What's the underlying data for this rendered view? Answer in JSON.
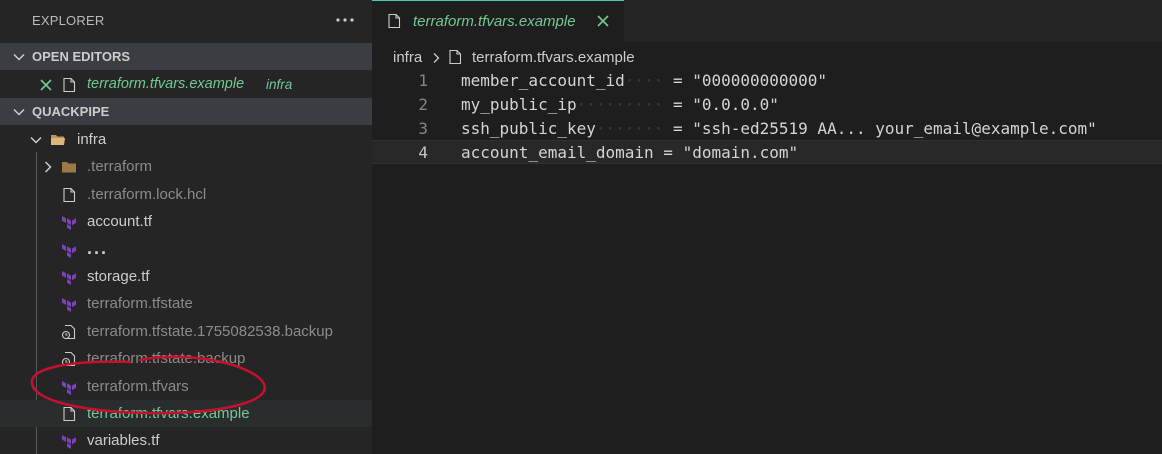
{
  "explorer": {
    "title": "EXPLORER",
    "open_editors": {
      "header": "OPEN EDITORS",
      "items": [
        {
          "name": "terraform.tfvars.example",
          "folder": "infra"
        }
      ]
    },
    "workspace": {
      "header": "QUACKPIPE",
      "folder": "infra",
      "items": [
        {
          "label": ".terraform",
          "kind": "folder",
          "state": "dim"
        },
        {
          "label": ".terraform.lock.hcl",
          "kind": "file",
          "state": "dim"
        },
        {
          "label": "account.tf",
          "kind": "terraform",
          "state": "normal"
        },
        {
          "label": "...",
          "kind": "terraform",
          "state": "normal"
        },
        {
          "label": "storage.tf",
          "kind": "terraform",
          "state": "normal"
        },
        {
          "label": "terraform.tfstate",
          "kind": "terraform",
          "state": "dim"
        },
        {
          "label": "terraform.tfstate.1755082538.backup",
          "kind": "backup",
          "state": "dim"
        },
        {
          "label": "terraform.tfstate.backup",
          "kind": "backup",
          "state": "dim"
        },
        {
          "label": "terraform.tfvars",
          "kind": "terraform",
          "state": "dim"
        },
        {
          "label": "terraform.tfvars.example",
          "kind": "file",
          "state": "modified"
        },
        {
          "label": "variables.tf",
          "kind": "terraform",
          "state": "normal"
        }
      ]
    }
  },
  "editor": {
    "tab": {
      "label": "terraform.tfvars.example"
    },
    "breadcrumb": {
      "folder": "infra",
      "file": "terraform.tfvars.example"
    },
    "lines": [
      {
        "number": "1",
        "key": "member_account_id",
        "pad": "····",
        "value": "= \"000000000000\""
      },
      {
        "number": "2",
        "key": "my_public_ip",
        "pad": "·········",
        "value": "= \"0.0.0.0\""
      },
      {
        "number": "3",
        "key": "ssh_public_key",
        "pad": "·······",
        "value": "= \"ssh-ed25519 AA... your_email@example.com\""
      },
      {
        "number": "4",
        "key": "account_email_domain",
        "pad": " ",
        "value": "= \"domain.com\""
      }
    ]
  },
  "colors": {
    "modified": "#73c991",
    "terraform": "#7b42bc",
    "annotation": "#c8102e"
  }
}
